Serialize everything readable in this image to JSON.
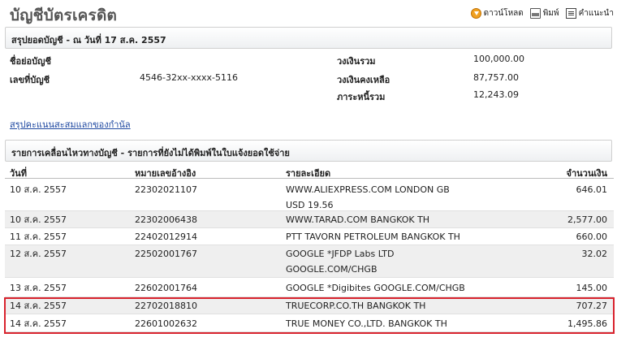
{
  "header": {
    "title": "บัญชีบัตรเครดิต",
    "tools": [
      {
        "label": "ดาวน์โหลด",
        "icon": "download-icon"
      },
      {
        "label": "พิมพ์",
        "icon": "print-icon"
      },
      {
        "label": "คำแนะนำ",
        "icon": "help-icon"
      }
    ]
  },
  "summary": {
    "title": "สรุปยอดบัญชี - ณ วันที่ 17 ส.ค. 2557",
    "account_name_label": "ชื่อย่อบัญชี",
    "account_name_value": "",
    "account_no_label": "เลขที่บัญชี",
    "account_no_value": "4546-32xx-xxxx-5116",
    "credit_limit_label": "วงเงินรวม",
    "credit_limit_value": "100,000.00",
    "available_label": "วงเงินคงเหลือ",
    "available_value": "87,757.00",
    "balance_label": "ภาระหนี้รวม",
    "balance_value": "12,243.09"
  },
  "rewards_link": "สรุปคะแนนสะสมแลกของกำนัล",
  "transactions": {
    "title": "รายการเคลื่อนไหวทางบัญชี - รายการที่ยังไม่ได้พิมพ์ในใบแจ้งยอดใช้จ่าย",
    "columns": [
      "วันที่",
      "หมายเลขอ้างอิง",
      "รายละเอียด",
      "จำนวนเงิน"
    ],
    "rows": [
      {
        "date": "10 ส.ค. 2557",
        "ref": "22302021107",
        "desc": "WWW.ALIEXPRESS.COM LONDON GB",
        "desc2": "USD 19.56",
        "amount": "646.01"
      },
      {
        "date": "10 ส.ค. 2557",
        "ref": "22302006438",
        "desc": "WWW.TARAD.COM BANGKOK TH",
        "desc2": "",
        "amount": "2,577.00"
      },
      {
        "date": "11 ส.ค. 2557",
        "ref": "22402012914",
        "desc": "PTT TAVORN PETROLEUM BANGKOK TH",
        "desc2": "",
        "amount": "660.00"
      },
      {
        "date": "12 ส.ค. 2557",
        "ref": "22502001767",
        "desc": "GOOGLE *JFDP Labs LTD",
        "desc2": "GOOGLE.COM/CHGB",
        "amount": "32.02"
      },
      {
        "date": "13 ส.ค. 2557",
        "ref": "22602001764",
        "desc": "GOOGLE *Digibites GOOGLE.COM/CHGB",
        "desc2": "",
        "amount": "145.00"
      },
      {
        "date": "14 ส.ค. 2557",
        "ref": "22702018810",
        "desc": "TRUECORP.CO.TH BANGKOK TH",
        "desc2": "",
        "amount": "707.27"
      },
      {
        "date": "14 ส.ค. 2557",
        "ref": "22601002632",
        "desc": "TRUE MONEY CO.,LTD. BANGKOK TH",
        "desc2": "",
        "amount": "1,495.86"
      }
    ]
  },
  "colors": {
    "highlight": "#d9232e",
    "link": "#1d47a0",
    "row_alt": "#efefef"
  }
}
